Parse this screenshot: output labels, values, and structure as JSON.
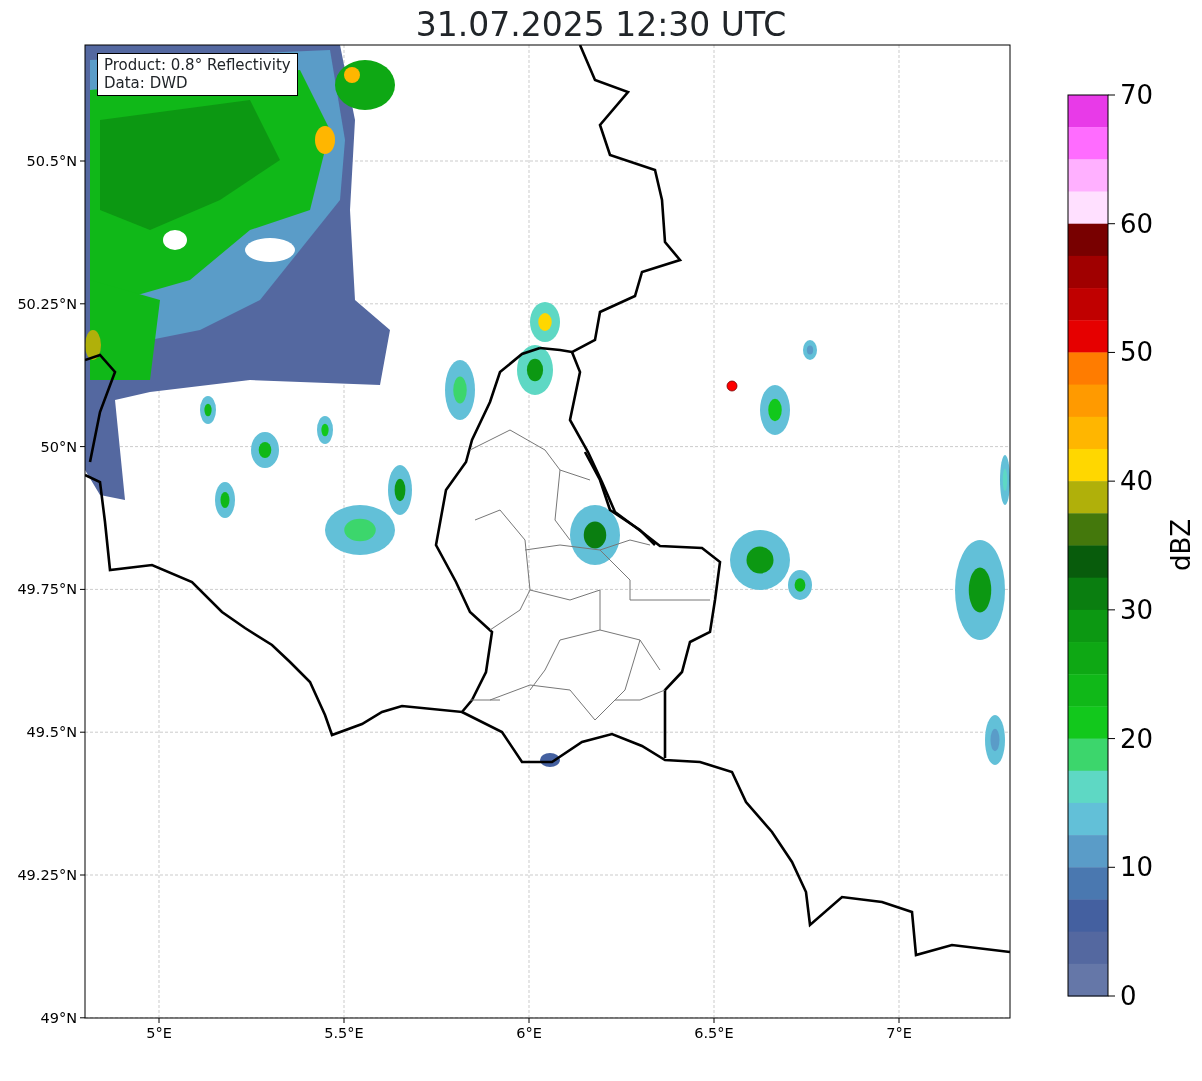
{
  "title": "31.07.2025 12:30 UTC",
  "info_box": [
    "Product: 0.8° Reflectivity",
    "Data: DWD"
  ],
  "axes": {
    "lat_ticks": [
      "50.5°N",
      "50.25°N",
      "50°N",
      "49.75°N",
      "49.5°N",
      "49.25°N",
      "49°N"
    ],
    "lon_ticks": [
      "5°E",
      "5.5°E",
      "6°E",
      "6.5°E",
      "7°E"
    ]
  },
  "colorbar": {
    "label": "dBZ",
    "ticks": [
      "70",
      "60",
      "50",
      "40",
      "30",
      "20",
      "10",
      "0"
    ],
    "bands": [
      {
        "color": "#e83ae8"
      },
      {
        "color": "#ff6cff"
      },
      {
        "color": "#ffb0ff"
      },
      {
        "color": "#ffe0ff"
      },
      {
        "color": "#780000"
      },
      {
        "color": "#a00000"
      },
      {
        "color": "#c00000"
      },
      {
        "color": "#e60000"
      },
      {
        "color": "#ff7c00"
      },
      {
        "color": "#ff9a00"
      },
      {
        "color": "#ffb600"
      },
      {
        "color": "#ffd700"
      },
      {
        "color": "#b0b00a"
      },
      {
        "color": "#44780c"
      },
      {
        "color": "#085c0c"
      },
      {
        "color": "#0a7e10"
      },
      {
        "color": "#0c9812"
      },
      {
        "color": "#0ea814"
      },
      {
        "color": "#10b818"
      },
      {
        "color": "#12c81c"
      },
      {
        "color": "#3cd66c"
      },
      {
        "color": "#5ed8c4"
      },
      {
        "color": "#62c0d8"
      },
      {
        "color": "#5a9cc8"
      },
      {
        "color": "#4a78b0"
      },
      {
        "color": "#4460a0"
      },
      {
        "color": "#5468a0"
      },
      {
        "color": "#6577a8"
      }
    ]
  }
}
